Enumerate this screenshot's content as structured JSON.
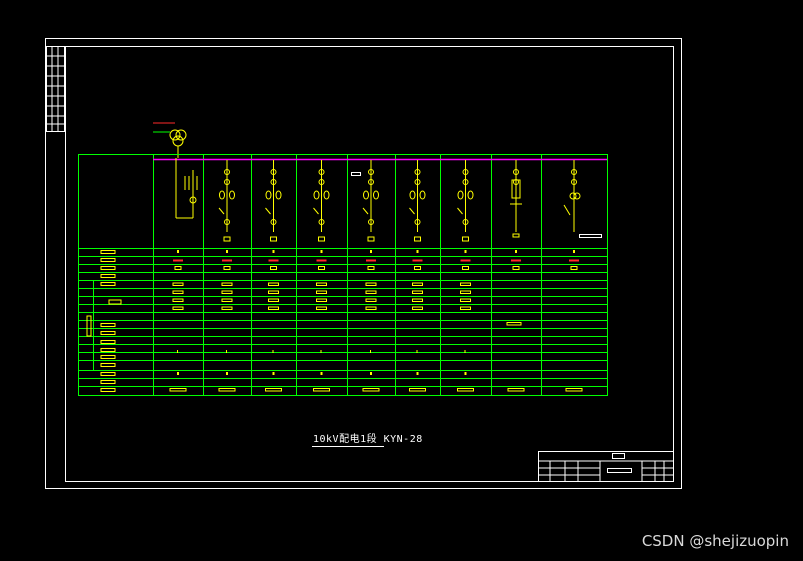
{
  "drawing": {
    "title": "10kV配电1段 KYN-28",
    "panel_count": 10
  },
  "watermark": "CSDN @shejizuopin",
  "colors": {
    "background": "#000000",
    "frame": "#ffffff",
    "grid": "#00ff00",
    "bus": "#ff00ff",
    "equipment": "#ffff00",
    "highlight": "#ff2a2a",
    "cyan": "#00ffff"
  }
}
